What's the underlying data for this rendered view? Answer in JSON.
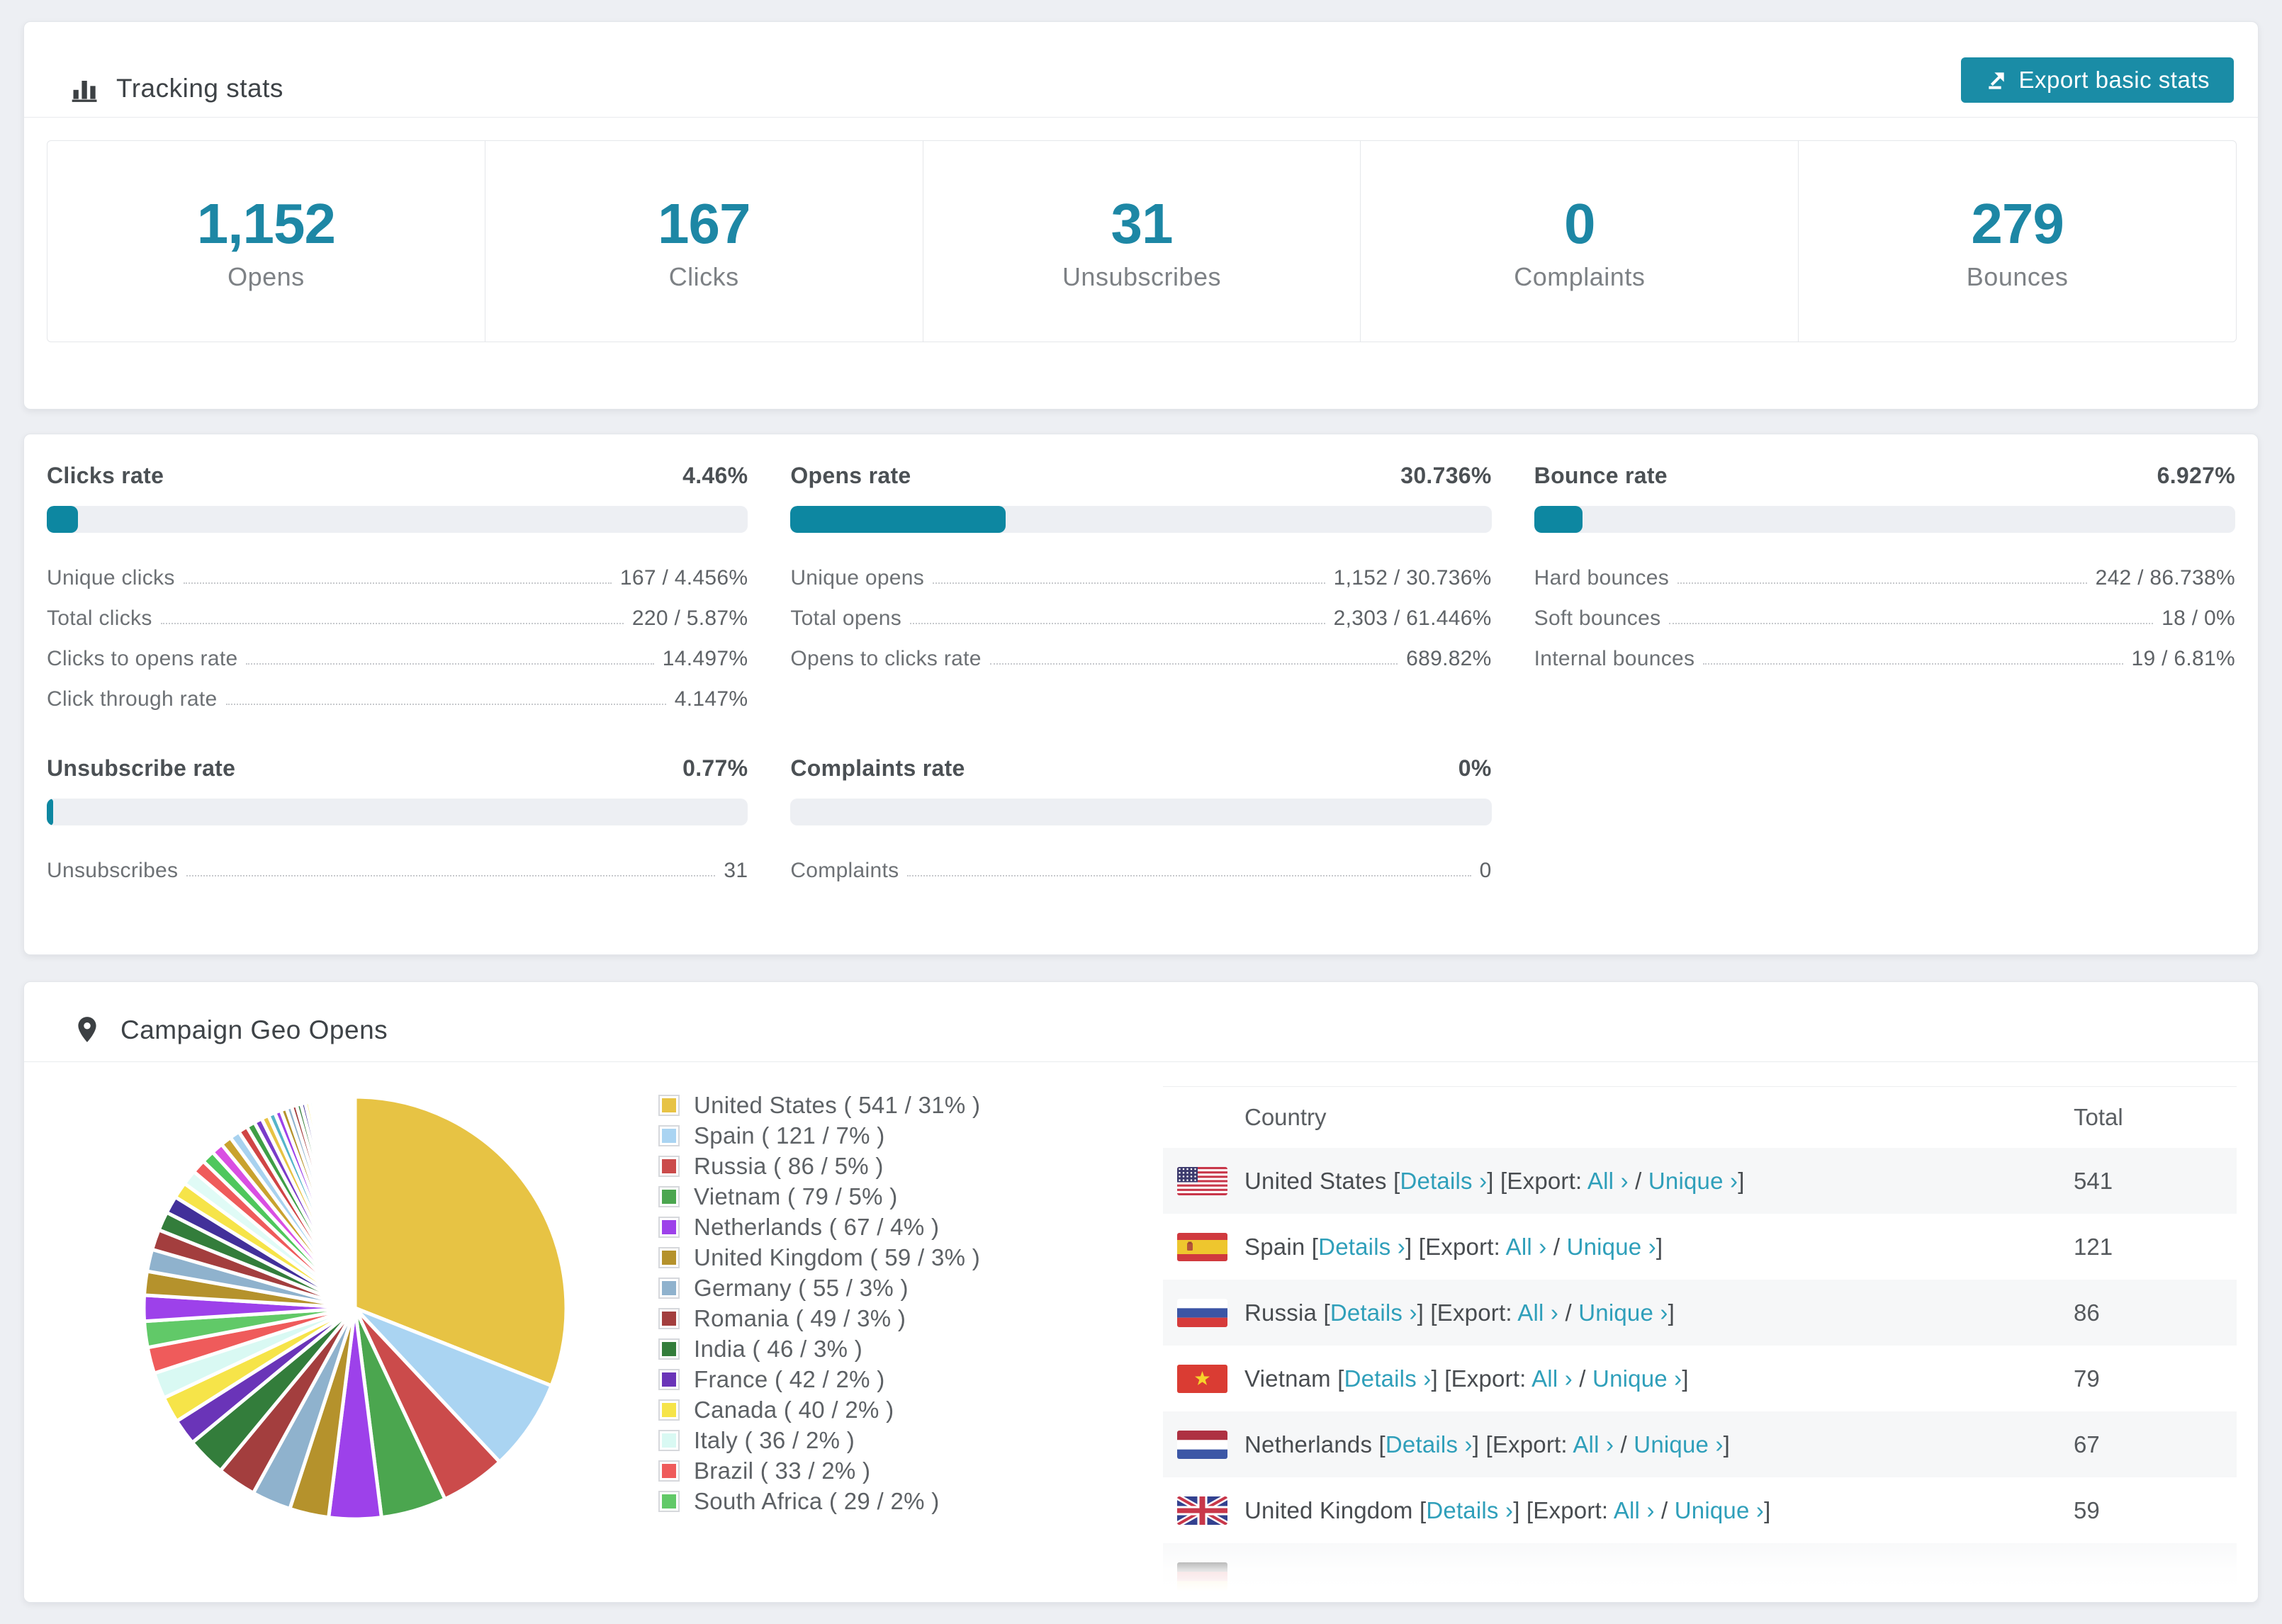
{
  "colors": {
    "accent": "#1a8ca6",
    "link": "#2f9fba",
    "bar_fill": "#0d87a1",
    "bar_track": "#edeff3"
  },
  "tracking": {
    "title": "Tracking stats",
    "export_button_label": "Export basic stats",
    "stats": [
      {
        "value": "1,152",
        "label": "Opens"
      },
      {
        "value": "167",
        "label": "Clicks"
      },
      {
        "value": "31",
        "label": "Unsubscribes"
      },
      {
        "value": "0",
        "label": "Complaints"
      },
      {
        "value": "279",
        "label": "Bounces"
      }
    ]
  },
  "rates": [
    {
      "title": "Clicks rate",
      "value": "4.46%",
      "pct": 4.46,
      "rows": [
        {
          "label": "Unique clicks",
          "value": "167 / 4.456%"
        },
        {
          "label": "Total clicks",
          "value": "220 / 5.87%"
        },
        {
          "label": "Clicks to opens rate",
          "value": "14.497%"
        },
        {
          "label": "Click through rate",
          "value": "4.147%"
        }
      ]
    },
    {
      "title": "Opens rate",
      "value": "30.736%",
      "pct": 30.736,
      "rows": [
        {
          "label": "Unique opens",
          "value": "1,152 / 30.736%"
        },
        {
          "label": "Total opens",
          "value": "2,303 / 61.446%"
        },
        {
          "label": "Opens to clicks rate",
          "value": "689.82%"
        }
      ]
    },
    {
      "title": "Bounce rate",
      "value": "6.927%",
      "pct": 6.927,
      "rows": [
        {
          "label": "Hard bounces",
          "value": "242 / 86.738%"
        },
        {
          "label": "Soft bounces",
          "value": "18 / 0%"
        },
        {
          "label": "Internal bounces",
          "value": "19 / 6.81%"
        }
      ]
    },
    {
      "title": "Unsubscribe rate",
      "value": "0.77%",
      "pct": 0.77,
      "rows": [
        {
          "label": "Unsubscribes",
          "value": "31"
        }
      ]
    },
    {
      "title": "Complaints rate",
      "value": "0%",
      "pct": 0,
      "rows": [
        {
          "label": "Complaints",
          "value": "0"
        }
      ]
    }
  ],
  "geo": {
    "title": "Campaign Geo Opens",
    "legend": [
      {
        "label": "United States ( 541 / 31% )",
        "color": "#e7c344"
      },
      {
        "label": "Spain ( 121 / 7% )",
        "color": "#aad4f2"
      },
      {
        "label": "Russia ( 86 / 5% )",
        "color": "#cb4b4b"
      },
      {
        "label": "Vietnam ( 79 / 5% )",
        "color": "#4ba64f"
      },
      {
        "label": "Netherlands ( 67 / 4% )",
        "color": "#9d41ea"
      },
      {
        "label": "United Kingdom ( 59 / 3% )",
        "color": "#b5922c"
      },
      {
        "label": "Germany ( 55 / 3% )",
        "color": "#8fb2cd"
      },
      {
        "label": "Romania ( 49 / 3% )",
        "color": "#a33e3e"
      },
      {
        "label": "India ( 46 / 3% )",
        "color": "#337d3b"
      },
      {
        "label": "France ( 42 / 2% )",
        "color": "#6a34b8"
      },
      {
        "label": "Canada ( 40 / 2% )",
        "color": "#f6e449"
      },
      {
        "label": "Italy ( 36 / 2% )",
        "color": "#d9f9f3"
      },
      {
        "label": "Brazil ( 33 / 2% )",
        "color": "#ef5b5b"
      },
      {
        "label": "South Africa ( 29 / 2% )",
        "color": "#61c968"
      }
    ],
    "table": {
      "country_header": "Country",
      "total_header": "Total",
      "labels": {
        "details": "Details ›",
        "export": "Export:",
        "all": "All ›",
        "unique": "Unique ›"
      },
      "symbols": {
        "open": "[",
        "close": "]",
        "slash": "/"
      },
      "rows": [
        {
          "country": "United States",
          "flag": "us",
          "total": "541",
          "partial": false
        },
        {
          "country": "Spain",
          "flag": "es",
          "total": "121",
          "partial": false
        },
        {
          "country": "Russia",
          "flag": "ru",
          "total": "86",
          "partial": false
        },
        {
          "country": "Vietnam",
          "flag": "vn",
          "total": "79",
          "partial": false
        },
        {
          "country": "Netherlands",
          "flag": "nl",
          "total": "67",
          "partial": false
        },
        {
          "country": "United Kingdom",
          "flag": "gb",
          "total": "59",
          "partial": false
        },
        {
          "country": "",
          "flag": "de",
          "total": "",
          "partial": true
        }
      ]
    }
  },
  "chart_data": {
    "type": "pie",
    "title": "Campaign Geo Opens",
    "legend_position": "right",
    "unit": "opens",
    "start_angle_deg": 0,
    "direction": "clockwise",
    "series": [
      {
        "name": "United States",
        "value": 541,
        "pct": 31,
        "color": "#e7c344"
      },
      {
        "name": "Spain",
        "value": 121,
        "pct": 7,
        "color": "#aad4f2"
      },
      {
        "name": "Russia",
        "value": 86,
        "pct": 5,
        "color": "#cb4b4b"
      },
      {
        "name": "Vietnam",
        "value": 79,
        "pct": 5,
        "color": "#4ba64f"
      },
      {
        "name": "Netherlands",
        "value": 67,
        "pct": 4,
        "color": "#9d41ea"
      },
      {
        "name": "United Kingdom",
        "value": 59,
        "pct": 3,
        "color": "#b5922c"
      },
      {
        "name": "Germany",
        "value": 55,
        "pct": 3,
        "color": "#8fb2cd"
      },
      {
        "name": "Romania",
        "value": 49,
        "pct": 3,
        "color": "#a33e3e"
      },
      {
        "name": "India",
        "value": 46,
        "pct": 3,
        "color": "#337d3b"
      },
      {
        "name": "France",
        "value": 42,
        "pct": 2,
        "color": "#6a34b8"
      },
      {
        "name": "Canada",
        "value": 40,
        "pct": 2,
        "color": "#f6e449"
      },
      {
        "name": "Italy",
        "value": 36,
        "pct": 2,
        "color": "#d9f9f3"
      },
      {
        "name": "Brazil",
        "value": 33,
        "pct": 2,
        "color": "#ef5b5b"
      },
      {
        "name": "South Africa",
        "value": 29,
        "pct": 2,
        "color": "#61c968"
      }
    ],
    "others_unlabeled": {
      "total_pct": 26,
      "slice_count": 60,
      "first_pct": 1.9,
      "decay": 0.925,
      "palette": [
        "#9d41ea",
        "#b5922c",
        "#8fb2cd",
        "#a33e3e",
        "#337d3b",
        "#42309a",
        "#f6e449",
        "#e0fbf6",
        "#ef5b5b",
        "#4fc75c",
        "#d94fe2",
        "#c9a22e",
        "#a8d2ef",
        "#d04545",
        "#3f9e46",
        "#7a3bc9",
        "#e7c344",
        "#55b4c9"
      ]
    }
  }
}
